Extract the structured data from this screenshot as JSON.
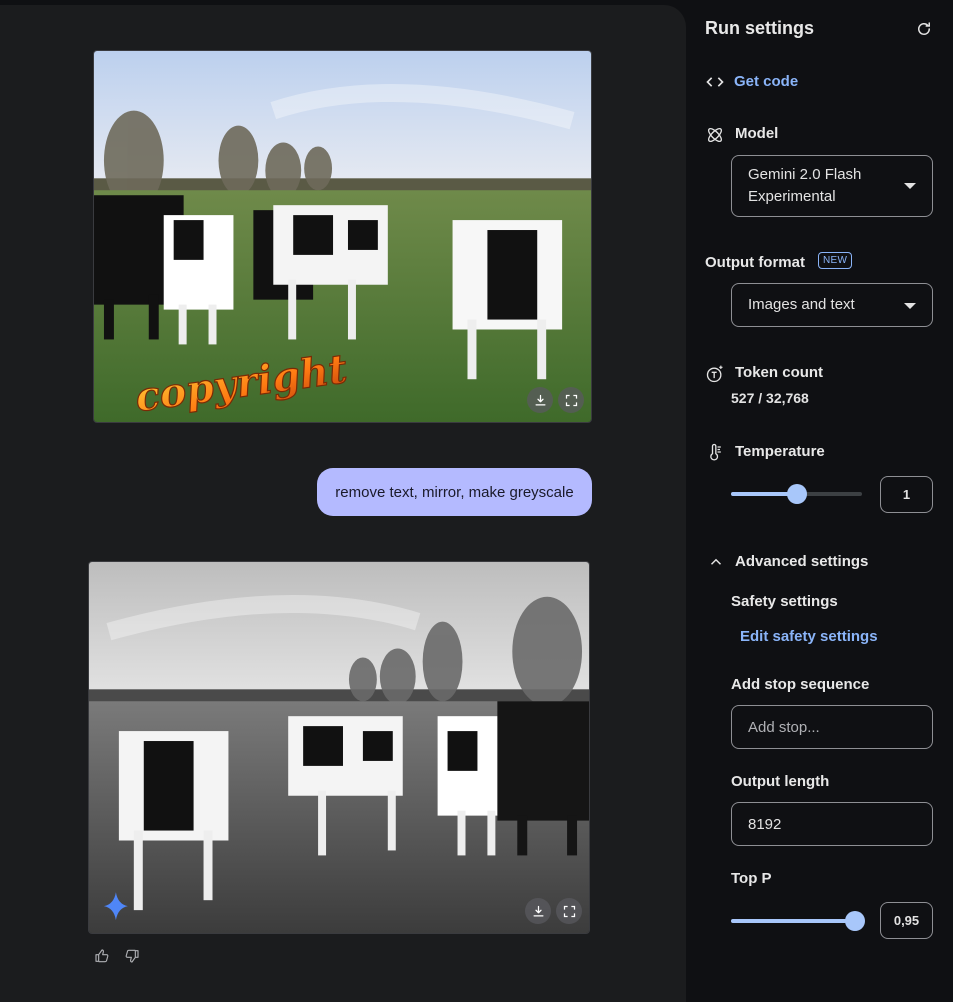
{
  "chat": {
    "user_message": "remove text, mirror, make greyscale",
    "first_image": {
      "overlay_text": "copyright"
    }
  },
  "settings": {
    "title": "Run settings",
    "get_code": "Get code",
    "model_label": "Model",
    "model_value_line1": "Gemini 2.0 Flash",
    "model_value_line2": "Experimental",
    "output_format_label": "Output format",
    "new_badge": "NEW",
    "output_format_value": "Images and text",
    "token_count_label": "Token count",
    "token_count_value": "527 / 32,768",
    "temperature_label": "Temperature",
    "temperature_value": "1",
    "temperature_fraction": 0.5,
    "advanced_label": "Advanced settings",
    "safety_label": "Safety settings",
    "edit_safety": "Edit safety settings",
    "stop_sequence_label": "Add stop sequence",
    "stop_placeholder": "Add stop...",
    "output_length_label": "Output length",
    "output_length_value": "8192",
    "top_p_label": "Top P",
    "top_p_value": "0,95",
    "top_p_fraction": 0.95
  },
  "colors": {
    "accent": "#8ab4f8",
    "bubble": "#b4baff",
    "slider": "#a8c7fa"
  }
}
